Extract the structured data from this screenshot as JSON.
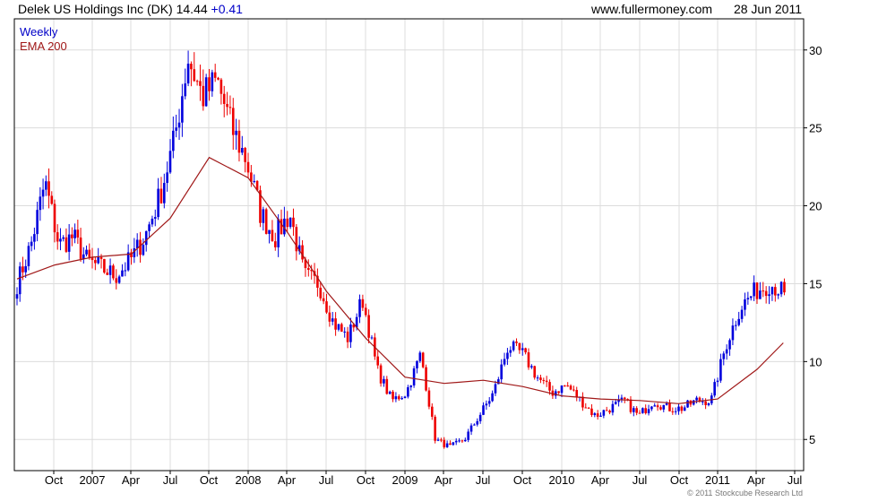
{
  "header": {
    "title": "Delek US Holdings Inc (DK) 14.44",
    "change": "+0.41",
    "site": "www.fullermoney.com",
    "date": "28 Jun 2011"
  },
  "legend": {
    "weekly": "Weekly",
    "ema": "EMA 200"
  },
  "copyright": "© 2011 Stockcube Research Ltd",
  "colors": {
    "up": "#0000dd",
    "down": "#ee0000",
    "ema": "#a01818",
    "grid": "#dcdcdc"
  },
  "chart_data": {
    "type": "line",
    "ylim": [
      3,
      32
    ],
    "y_ticks": [
      5,
      10,
      15,
      20,
      25,
      30
    ],
    "x_tick_labels": [
      "Oct",
      "2007",
      "Apr",
      "Jul",
      "Oct",
      "2008",
      "Apr",
      "Jul",
      "Oct",
      "2009",
      "Apr",
      "Jul",
      "Oct",
      "2010",
      "Apr",
      "Jul",
      "Oct",
      "2011",
      "Apr",
      "Jul"
    ],
    "grid": true,
    "legend_position": "top-left",
    "series": [
      {
        "name": "Weekly",
        "style": "candlestick",
        "period": [
          "Jul 2006",
          "Jun 2011"
        ],
        "close_approx": [
          15.0,
          17.5,
          21.5,
          17.5,
          18.0,
          16.5,
          16.0,
          15.5,
          16.5,
          18.0,
          20.5,
          24.0,
          29.5,
          27.0,
          28.0,
          25.0,
          23.0,
          19.5,
          18.0,
          19.5,
          15.5,
          15.0,
          12.5,
          11.5,
          14.0,
          9.5,
          7.5,
          8.0,
          10.5,
          5.0,
          4.5,
          5.0,
          6.5,
          8.0,
          11.0,
          10.5,
          9.0,
          8.0,
          8.5,
          7.5,
          6.5,
          7.0,
          7.5,
          6.5,
          7.5,
          7.0,
          7.0,
          7.5,
          7.5,
          11.0,
          13.5,
          14.5,
          15.0,
          14.44
        ],
        "ylim": [
          3,
          32
        ]
      },
      {
        "name": "EMA 200",
        "style": "line",
        "x": [
          "Jul 2006",
          "Oct 2006",
          "Jan 2007",
          "Apr 2007",
          "Jul 2007",
          "Oct 2007",
          "Jan 2008",
          "Apr 2008",
          "Jul 2008",
          "Oct 2008",
          "Jan 2009",
          "Apr 2009",
          "Jul 2009",
          "Oct 2009",
          "Jan 2010",
          "Apr 2010",
          "Jul 2010",
          "Oct 2010",
          "Jan 2011",
          "Apr 2011",
          "Jun 2011"
        ],
        "values": [
          15.3,
          16.2,
          16.7,
          16.9,
          19.2,
          23.1,
          21.8,
          18.3,
          14.5,
          11.5,
          9.0,
          8.6,
          8.8,
          8.4,
          7.8,
          7.6,
          7.5,
          7.3,
          7.6,
          9.5,
          11.2
        ]
      }
    ]
  }
}
